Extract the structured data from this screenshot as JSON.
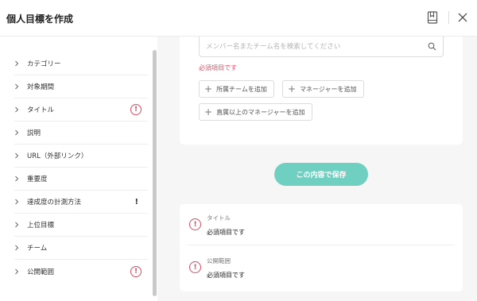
{
  "header": {
    "title": "個人目標を作成",
    "bookmark_icon": "bookmark-icon",
    "close_icon": "close-icon"
  },
  "sidebar": {
    "items": [
      {
        "label": "カテゴリー",
        "status": "none"
      },
      {
        "label": "対象期間",
        "status": "none"
      },
      {
        "label": "タイトル",
        "status": "error",
        "status_symbol": "!"
      },
      {
        "label": "説明",
        "status": "none"
      },
      {
        "label": "URL（外部リンク）",
        "status": "none"
      },
      {
        "label": "重要度",
        "status": "none"
      },
      {
        "label": "達成度の計測方法",
        "status": "warning",
        "status_symbol": "!"
      },
      {
        "label": "上位目標",
        "status": "none"
      },
      {
        "label": "チーム",
        "status": "none"
      },
      {
        "label": "公開範囲",
        "status": "error",
        "status_symbol": "!"
      }
    ]
  },
  "form": {
    "search_placeholder": "メンバー名またチーム名を検索してください",
    "required_message": "必須項目です",
    "add_buttons": [
      "所属チームを追加",
      "マネージャーを追加",
      "直属以上のマネージャーを追加"
    ],
    "add_symbol": "+"
  },
  "save_label": "この内容で保存",
  "errors": {
    "items": [
      {
        "field": "タイトル",
        "message": "必須項目です",
        "symbol": "!"
      },
      {
        "field": "公開範囲",
        "message": "必須項目です",
        "symbol": "!"
      }
    ]
  },
  "colors": {
    "accent": "#6fd0c1",
    "error": "#d94a63",
    "required_text": "#e0536a"
  }
}
